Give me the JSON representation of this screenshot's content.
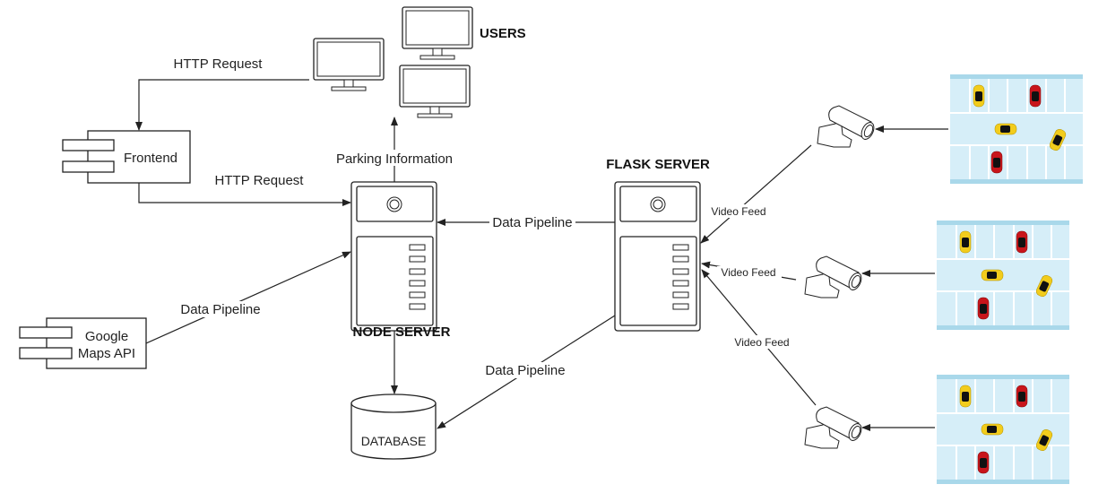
{
  "nodes": {
    "users": "USERS",
    "frontend": "Frontend",
    "google_maps_api": [
      "Google",
      "Maps API"
    ],
    "node_server": "NODE SERVER",
    "flask_server": "FLASK SERVER",
    "database": "DATABASE"
  },
  "edges": {
    "users_to_frontend": "HTTP Request",
    "frontend_to_node": "HTTP Request",
    "node_to_users": "Parking Information",
    "flask_to_node": "Data Pipeline",
    "maps_to_node": "Data Pipeline",
    "flask_to_database": "Data Pipeline",
    "camera1_to_flask": "Video Feed",
    "camera2_to_flask": "Video Feed",
    "camera3_to_flask": "Video Feed"
  },
  "colors": {
    "parking_lot": "#d6eef8",
    "parking_border": "#a9d8ea",
    "car_yellow": "#f2cc1c",
    "car_red": "#c8151b"
  }
}
